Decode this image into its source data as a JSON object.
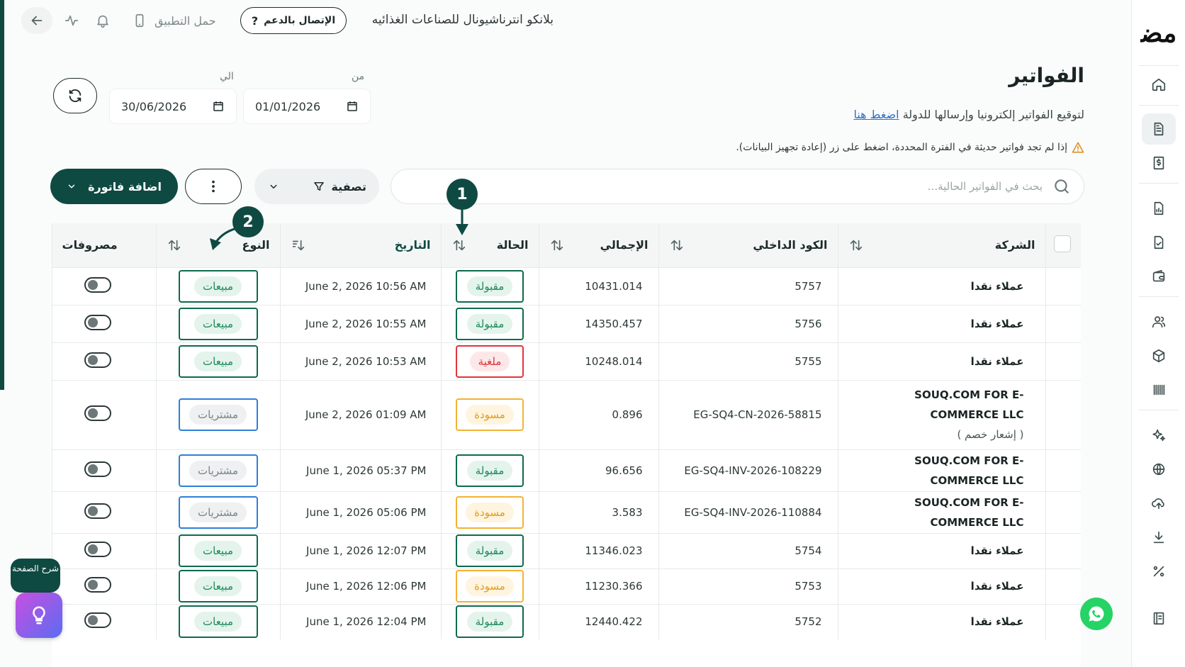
{
  "topbar": {
    "company_name": "بلانكو انترناشيونال للصناعات الغذائيه",
    "support_label": "الإتصال بالدعم",
    "download_app_label": "حمل التطبيق"
  },
  "page": {
    "title": "الفواتير",
    "subtitle": "لتوقيع الفواتير إلكترونيا وإرسالها للدولة",
    "subtitle_link": "اضغط هنا",
    "warning": "إذا لم تجد فواتير حديثة في الفترة المحددة، اضغط على زر (إعادة تجهيز البيانات)."
  },
  "dates": {
    "from_label": "من",
    "from_value": "01/01/2026",
    "to_label": "الي",
    "to_value": "30/06/2026"
  },
  "toolbar": {
    "search_placeholder": "بحث في الفواتير الحالية...",
    "filter_label": "تصفية",
    "add_label": "اضافة فاتورة"
  },
  "table": {
    "columns": {
      "company": "الشركة",
      "code": "الكود الداخلي",
      "total": "الإجمالي",
      "status": "الحالة",
      "date": "التاريخ",
      "type": "النوع",
      "expenses": "مصروفات"
    },
    "rows": [
      {
        "company": "عملاء نقدا",
        "company_sub": "",
        "code": "5757",
        "total": "10431.014",
        "status": "مقبولة",
        "status_kind": "accepted",
        "date": "June 2, 2026 10:56 AM",
        "type": "مبيعات",
        "type_kind": "sales"
      },
      {
        "company": "عملاء نقدا",
        "company_sub": "",
        "code": "5756",
        "total": "14350.457",
        "status": "مقبولة",
        "status_kind": "accepted",
        "date": "June 2, 2026 10:55 AM",
        "type": "مبيعات",
        "type_kind": "sales"
      },
      {
        "company": "عملاء نقدا",
        "company_sub": "",
        "code": "5755",
        "total": "10248.014",
        "status": "ملغية",
        "status_kind": "cancel",
        "date": "June 2, 2026 10:53 AM",
        "type": "مبيعات",
        "type_kind": "sales"
      },
      {
        "company": "SOUQ.COM FOR E-COMMERCE LLC",
        "company_sub": "( إشعار خصم )",
        "code": "EG-SQ4-CN-2026-58815",
        "total": "0.896",
        "status": "مسودة",
        "status_kind": "draft",
        "date": "June 2, 2026 01:09 AM",
        "type": "مشتريات",
        "type_kind": "purch"
      },
      {
        "company": "SOUQ.COM FOR E-COMMERCE LLC",
        "company_sub": "",
        "code": "EG-SQ4-INV-2026-108229",
        "total": "96.656",
        "status": "مقبولة",
        "status_kind": "accepted",
        "date": "June 1, 2026 05:37 PM",
        "type": "مشتريات",
        "type_kind": "purch"
      },
      {
        "company": "SOUQ.COM FOR E-COMMERCE LLC",
        "company_sub": "",
        "code": "EG-SQ4-INV-2026-110884",
        "total": "3.583",
        "status": "مسودة",
        "status_kind": "draft",
        "date": "June 1, 2026 05:06 PM",
        "type": "مشتريات",
        "type_kind": "purch"
      },
      {
        "company": "عملاء نقدا",
        "company_sub": "",
        "code": "5754",
        "total": "11346.023",
        "status": "مقبولة",
        "status_kind": "accepted",
        "date": "June 1, 2026 12:07 PM",
        "type": "مبيعات",
        "type_kind": "sales"
      },
      {
        "company": "عملاء نقدا",
        "company_sub": "",
        "code": "5753",
        "total": "11230.366",
        "status": "مسودة",
        "status_kind": "draft",
        "date": "June 1, 2026 12:06 PM",
        "type": "مبيعات",
        "type_kind": "sales"
      },
      {
        "company": "عملاء نقدا",
        "company_sub": "",
        "code": "5752",
        "total": "12440.422",
        "status": "مقبولة",
        "status_kind": "accepted",
        "date": "June 1, 2026 12:04 PM",
        "type": "مبيعات",
        "type_kind": "sales"
      }
    ]
  },
  "annotations": {
    "marker_1": "1",
    "marker_2": "2"
  },
  "help": {
    "label": "شرح الصفحة"
  },
  "colors": {
    "brand": "#0e4a42",
    "accepted": "#1d8a5b",
    "cancelled": "#d8363d",
    "draft": "#e39b1b",
    "purchases_frame": "#2f7fd8"
  }
}
